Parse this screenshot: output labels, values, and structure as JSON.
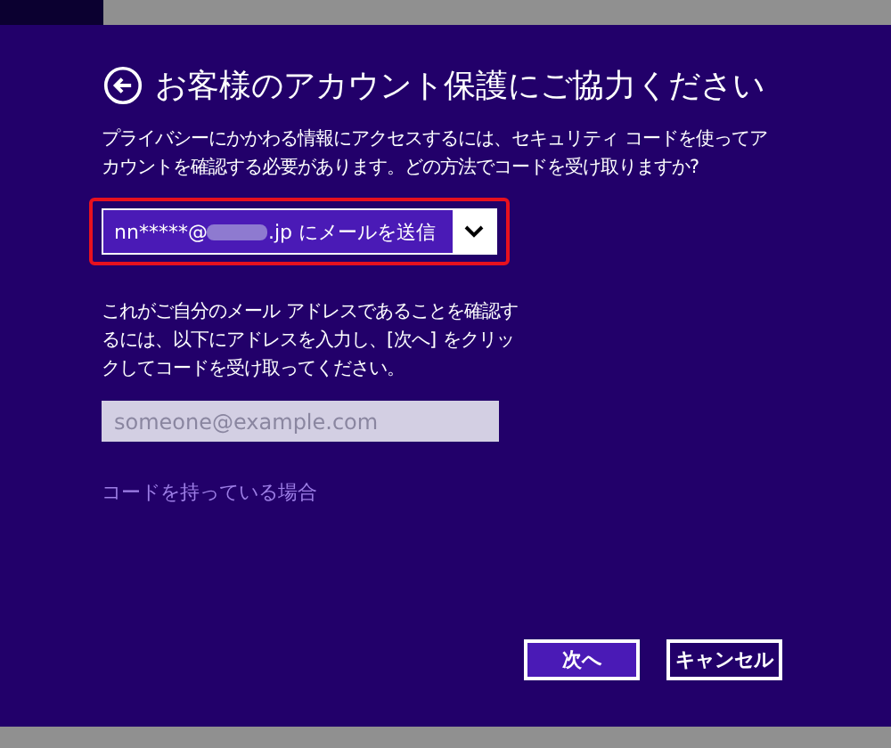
{
  "title": "お客様のアカウント保護にご協力ください",
  "intro": "プライバシーにかかわる情報にアクセスするには、セキュリティ コードを使ってアカウントを確認する必要があります。どの方法でコードを受け取りますか?",
  "method_dropdown": {
    "value_prefix": "nn*****@",
    "value_suffix": ".jp にメールを送信",
    "highlighted": true
  },
  "instructions": "これがご自分のメール アドレスであることを確認するには、以下にアドレスを入力し、[次へ] をクリックしてコードを受け取ってください。",
  "email_field": {
    "placeholder": "someone@example.com"
  },
  "code_link": "コードを持っている場合",
  "buttons": [
    {
      "label": "次へ",
      "kind": "primary"
    },
    {
      "label": "キャンセル",
      "kind": "secondary"
    }
  ]
}
